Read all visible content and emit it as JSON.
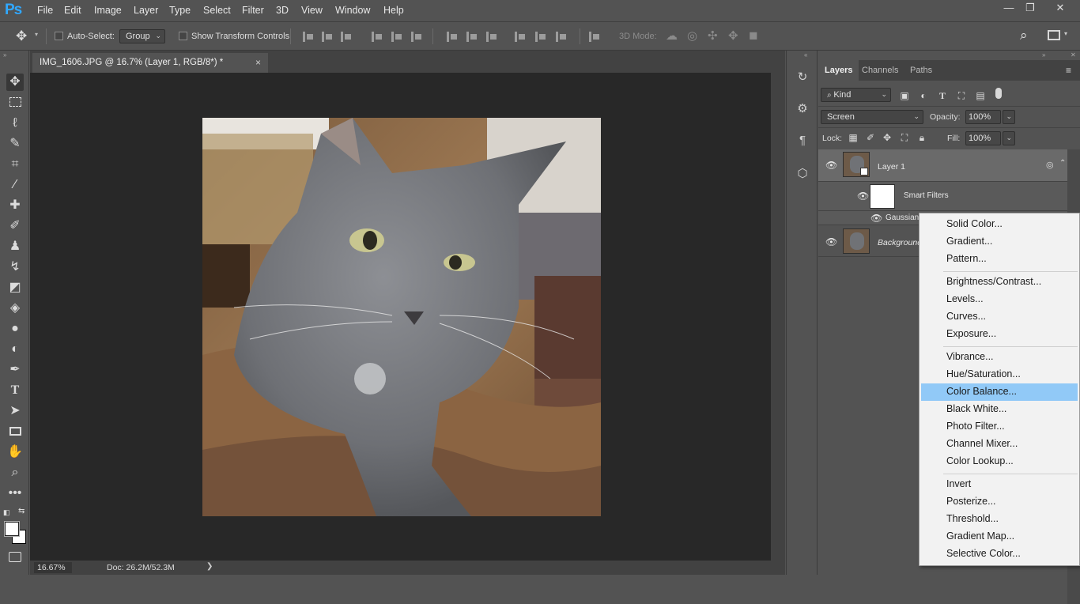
{
  "app": {
    "logo": "Ps"
  },
  "menubar": {
    "items": [
      "File",
      "Edit",
      "Image",
      "Layer",
      "Type",
      "Select",
      "Filter",
      "3D",
      "View",
      "Window",
      "Help"
    ]
  },
  "window_controls": {
    "minimize": "—",
    "restore": "❐",
    "close": "✕"
  },
  "options_bar": {
    "auto_select_label": "Auto-Select:",
    "auto_select_target": "Group",
    "show_transform_label": "Show Transform Controls",
    "mode_3d_label": "3D Mode:"
  },
  "document": {
    "tab_title": "IMG_1606.JPG @ 16.7% (Layer 1, RGB/8*) *",
    "tab_close": "×",
    "zoom": "16.67%",
    "doc_info": "Doc: 26.2M/52.3M",
    "status_arrow": "❯"
  },
  "panel": {
    "tabs": [
      "Layers",
      "Channels",
      "Paths"
    ],
    "filter_kind": "Kind",
    "blend_mode": "Screen",
    "opacity_label": "Opacity:",
    "opacity_value": "100%",
    "lock_label": "Lock:",
    "fill_label": "Fill:",
    "fill_value": "100%",
    "layers": [
      {
        "name": "Layer 1"
      },
      {
        "name": "Smart Filters"
      },
      {
        "name": "Gaussian"
      },
      {
        "name": "Background"
      }
    ]
  },
  "context_menu": {
    "groups": [
      [
        "Solid Color...",
        "Gradient...",
        "Pattern..."
      ],
      [
        "Brightness/Contrast...",
        "Levels...",
        "Curves...",
        "Exposure..."
      ],
      [
        "Vibrance...",
        "Hue/Saturation...",
        "Color Balance...",
        "Black  White...",
        "Photo Filter...",
        "Channel Mixer...",
        "Color Lookup..."
      ],
      [
        "Invert",
        "Posterize...",
        "Threshold...",
        "Gradient Map...",
        "Selective Color..."
      ]
    ],
    "highlighted": "Color Balance..."
  },
  "colors": {
    "ui_bg": "#535353",
    "canvas_bg": "#282828",
    "menu_highlight": "#91c9f7",
    "ps_blue": "#31a8ff"
  }
}
